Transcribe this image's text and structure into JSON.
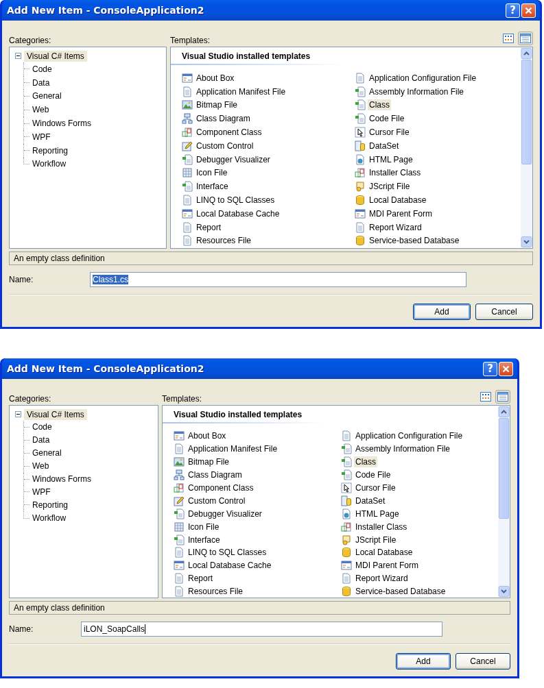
{
  "dialogs": [
    {
      "title": "Add New Item - ConsoleApplication2",
      "help_button": "?",
      "categories_label": "Categories:",
      "templates_label": "Templates:",
      "view_buttons": [
        {
          "kind": "large-icons",
          "selected": false
        },
        {
          "kind": "small-icons",
          "selected": true
        }
      ],
      "tree": {
        "label": "Visual C# Items",
        "expanded": true,
        "selected": true,
        "children": [
          {
            "label": "Code"
          },
          {
            "label": "Data"
          },
          {
            "label": "General"
          },
          {
            "label": "Web"
          },
          {
            "label": "Windows Forms"
          },
          {
            "label": "WPF"
          },
          {
            "label": "Reporting"
          },
          {
            "label": "Workflow"
          }
        ]
      },
      "section_heading": "Visual Studio installed templates",
      "templates": [
        {
          "label": "About Box",
          "selected": false
        },
        {
          "label": "Application Configuration File",
          "selected": false
        },
        {
          "label": "Application Manifest File",
          "selected": false
        },
        {
          "label": "Assembly Information File",
          "selected": false
        },
        {
          "label": "Bitmap File",
          "selected": false
        },
        {
          "label": "Class",
          "selected": true
        },
        {
          "label": "Class Diagram",
          "selected": false
        },
        {
          "label": "Code File",
          "selected": false
        },
        {
          "label": "Component Class",
          "selected": false
        },
        {
          "label": "Cursor File",
          "selected": false
        },
        {
          "label": "Custom Control",
          "selected": false
        },
        {
          "label": "DataSet",
          "selected": false
        },
        {
          "label": "Debugger Visualizer",
          "selected": false
        },
        {
          "label": "HTML Page",
          "selected": false
        },
        {
          "label": "Icon File",
          "selected": false
        },
        {
          "label": "Installer Class",
          "selected": false
        },
        {
          "label": "Interface",
          "selected": false
        },
        {
          "label": "JScript File",
          "selected": false
        },
        {
          "label": "LINQ to SQL Classes",
          "selected": false
        },
        {
          "label": "Local Database",
          "selected": false
        },
        {
          "label": "Local Database Cache",
          "selected": false
        },
        {
          "label": "MDI Parent Form",
          "selected": false
        },
        {
          "label": "Report",
          "selected": false
        },
        {
          "label": "Report Wizard",
          "selected": false
        },
        {
          "label": "Resources File",
          "selected": false
        },
        {
          "label": "Service-based Database",
          "selected": false
        }
      ],
      "description": "An empty class definition",
      "name_label": "Name:",
      "name_field": {
        "value": "Class1.cs",
        "text_selected": true
      },
      "buttons": [
        {
          "label": "Add",
          "default": true
        },
        {
          "label": "Cancel",
          "default": false
        }
      ]
    },
    {
      "title": "Add New Item - ConsoleApplication2",
      "help_button": "?",
      "categories_label": "Categories:",
      "templates_label": "Templates:",
      "view_buttons": [
        {
          "kind": "large-icons",
          "selected": false
        },
        {
          "kind": "small-icons",
          "selected": true
        }
      ],
      "tree": {
        "label": "Visual C# Items",
        "expanded": true,
        "selected": true,
        "children": [
          {
            "label": "Code"
          },
          {
            "label": "Data"
          },
          {
            "label": "General"
          },
          {
            "label": "Web"
          },
          {
            "label": "Windows Forms"
          },
          {
            "label": "WPF"
          },
          {
            "label": "Reporting"
          },
          {
            "label": "Workflow"
          }
        ]
      },
      "section_heading": "Visual Studio installed templates",
      "templates": [
        {
          "label": "About Box",
          "selected": false
        },
        {
          "label": "Application Configuration File",
          "selected": false
        },
        {
          "label": "Application Manifest File",
          "selected": false
        },
        {
          "label": "Assembly Information File",
          "selected": false
        },
        {
          "label": "Bitmap File",
          "selected": false
        },
        {
          "label": "Class",
          "selected": true
        },
        {
          "label": "Class Diagram",
          "selected": false
        },
        {
          "label": "Code File",
          "selected": false
        },
        {
          "label": "Component Class",
          "selected": false
        },
        {
          "label": "Cursor File",
          "selected": false
        },
        {
          "label": "Custom Control",
          "selected": false
        },
        {
          "label": "DataSet",
          "selected": false
        },
        {
          "label": "Debugger Visualizer",
          "selected": false
        },
        {
          "label": "HTML Page",
          "selected": false
        },
        {
          "label": "Icon File",
          "selected": false
        },
        {
          "label": "Installer Class",
          "selected": false
        },
        {
          "label": "Interface",
          "selected": false
        },
        {
          "label": "JScript File",
          "selected": false
        },
        {
          "label": "LINQ to SQL Classes",
          "selected": false
        },
        {
          "label": "Local Database",
          "selected": false
        },
        {
          "label": "Local Database Cache",
          "selected": false
        },
        {
          "label": "MDI Parent Form",
          "selected": false
        },
        {
          "label": "Report",
          "selected": false
        },
        {
          "label": "Report Wizard",
          "selected": false
        },
        {
          "label": "Resources File",
          "selected": false
        },
        {
          "label": "Service-based Database",
          "selected": false
        }
      ],
      "description": "An empty class definition",
      "name_label": "Name:",
      "name_field": {
        "value": "iLON_SoapCalls",
        "text_selected": false
      },
      "buttons": [
        {
          "label": "Add",
          "default": true
        },
        {
          "label": "Cancel",
          "default": false
        }
      ]
    }
  ]
}
